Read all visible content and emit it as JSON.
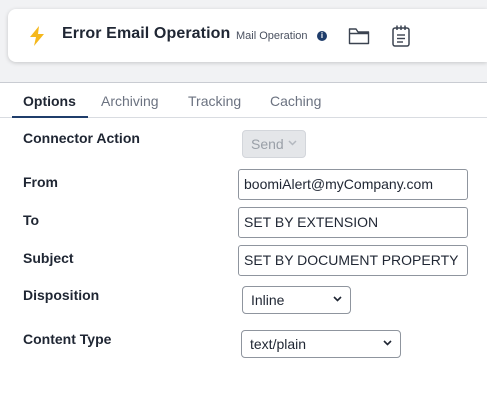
{
  "header": {
    "title": "Error Email Operation",
    "subtitle": "Mail Operation",
    "info_glyph": "i",
    "icons": [
      "lightning-bolt-icon",
      "folder-icon",
      "notes-icon",
      "info-icon"
    ],
    "accent_color": "#f5b81c"
  },
  "tabs": [
    {
      "label": "Options",
      "active": true
    },
    {
      "label": "Archiving",
      "active": false
    },
    {
      "label": "Tracking",
      "active": false
    },
    {
      "label": "Caching",
      "active": false
    }
  ],
  "form": {
    "connector_action": {
      "label": "Connector Action",
      "value": "Send",
      "disabled": true
    },
    "from": {
      "label": "From",
      "value": "boomiAlert@myCompany.com"
    },
    "to": {
      "label": "To",
      "value": "SET BY EXTENSION"
    },
    "subject": {
      "label": "Subject",
      "value": "SET BY DOCUMENT PROPERTY"
    },
    "disposition": {
      "label": "Disposition",
      "value": "Inline"
    },
    "content_type": {
      "label": "Content Type",
      "value": "text/plain"
    }
  }
}
